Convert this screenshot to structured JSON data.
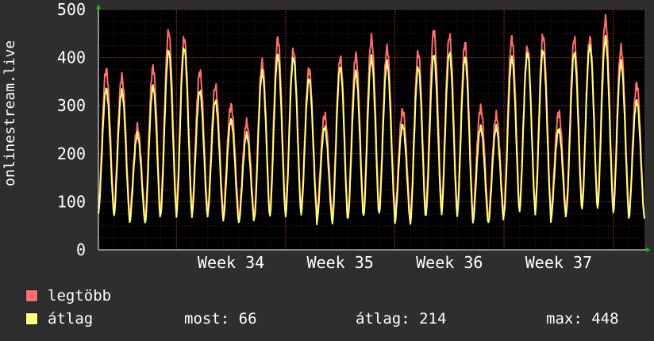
{
  "chart_data": {
    "type": "line",
    "ylabel": "onlinestream.live",
    "ylim": [
      0,
      500
    ],
    "y_ticks": [
      0,
      100,
      200,
      300,
      400,
      500
    ],
    "x_ticks": [
      "Week 34",
      "Week 35",
      "Week 36",
      "Week 37"
    ],
    "grid": true,
    "legend_placement": "bottom",
    "daily": {
      "x_unit": "days",
      "x_range": [
        0,
        35
      ],
      "peaks_max": [
        375,
        360,
        255,
        380,
        455,
        440,
        370,
        340,
        300,
        265,
        390,
        440,
        415,
        375,
        280,
        400,
        405,
        440,
        420,
        290,
        410,
        455,
        445,
        430,
        295,
        280,
        440,
        420,
        445,
        285,
        440,
        440,
        480,
        420,
        345
      ],
      "peaks_avg": [
        335,
        330,
        240,
        340,
        415,
        420,
        330,
        310,
        270,
        240,
        370,
        405,
        400,
        355,
        255,
        380,
        370,
        400,
        390,
        260,
        380,
        405,
        410,
        400,
        255,
        255,
        400,
        410,
        415,
        250,
        410,
        425,
        440,
        390,
        310
      ],
      "troughs_max": [
        85,
        80,
        70,
        65,
        90,
        85,
        80,
        80,
        75,
        65,
        75,
        80,
        80,
        85,
        70,
        65,
        75,
        80,
        85,
        70,
        65,
        90,
        85,
        80,
        70,
        65,
        85,
        90,
        85,
        70,
        90,
        95,
        95,
        85,
        65
      ],
      "troughs_avg": [
        75,
        70,
        55,
        55,
        75,
        70,
        70,
        70,
        60,
        55,
        65,
        70,
        70,
        75,
        55,
        55,
        65,
        70,
        75,
        55,
        55,
        75,
        75,
        70,
        55,
        55,
        75,
        80,
        75,
        60,
        80,
        85,
        85,
        75,
        65
      ]
    },
    "series": [
      {
        "name": "legtöbb",
        "color": "#ff7070"
      },
      {
        "name": "átlag",
        "color": "#ffff80"
      }
    ]
  },
  "legend": {
    "series1_label": "legtöbb",
    "series2_label": "átlag",
    "most": "most: 66",
    "atlag": "átlag: 214",
    "max": "max: 448"
  },
  "colors": {
    "background": "#2e2e2e",
    "plot_background": "#000000",
    "grid": "#603030",
    "max_line": "#ff7070",
    "avg_line": "#ffff80",
    "axis_arrow": "#00c000"
  }
}
